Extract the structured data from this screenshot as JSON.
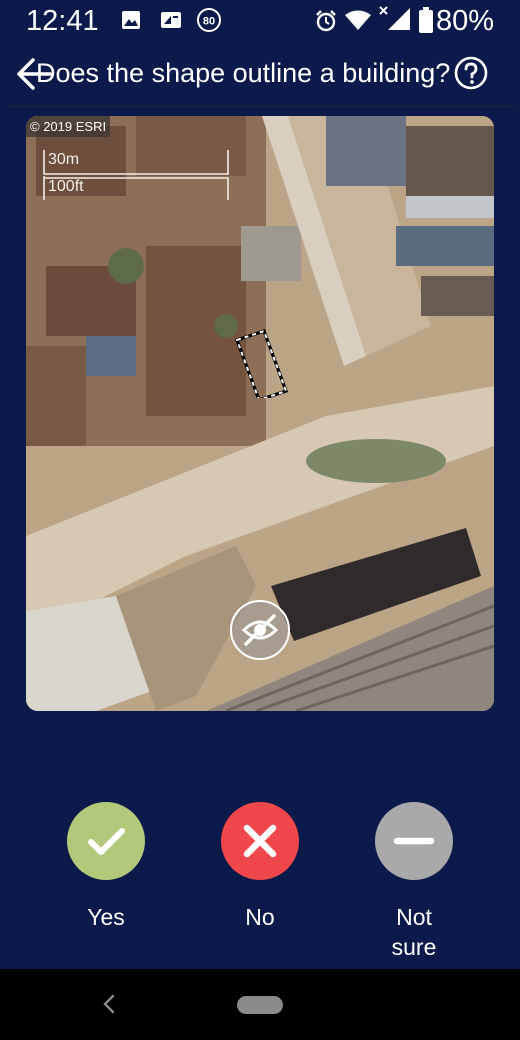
{
  "status_bar": {
    "time": "12:41",
    "notification_badge": "80",
    "battery": "80%"
  },
  "header": {
    "title": "Does the shape outline a building?"
  },
  "map": {
    "copyright": "© 2019 ESRI",
    "scale_metric": "30m",
    "scale_imperial": "100ft"
  },
  "answers": {
    "yes": {
      "label": "Yes",
      "color": "#b3c97a"
    },
    "no": {
      "label": "No",
      "color": "#f0474d"
    },
    "not_sure": {
      "label_line1": "Not",
      "label_line2": "sure",
      "color": "#a9a9a9"
    }
  },
  "colors": {
    "background": "#0c1a4b",
    "navbar": "#000000"
  }
}
